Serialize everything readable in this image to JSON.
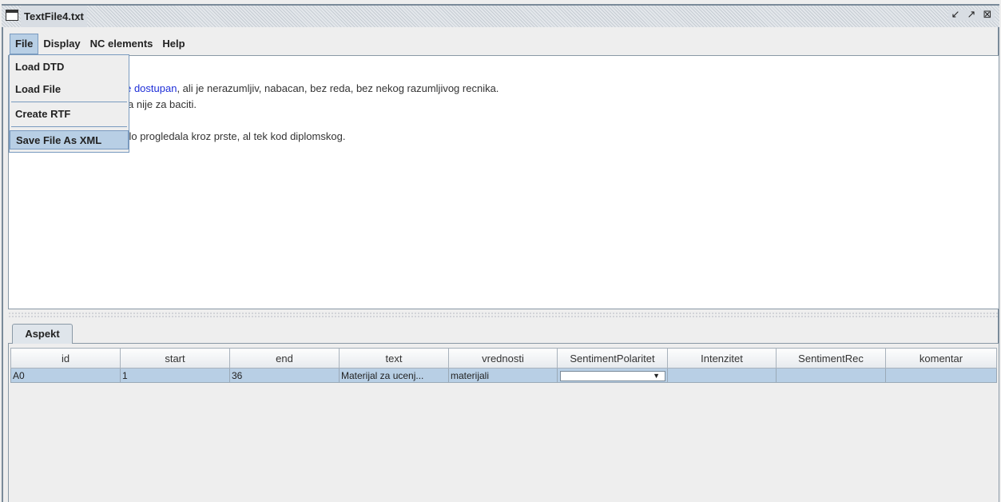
{
  "window": {
    "title": "TextFile4.txt"
  },
  "menubar": {
    "items": [
      "File",
      "Display",
      "NC elements",
      "Help"
    ]
  },
  "file_menu": {
    "items": [
      "Load DTD",
      "Load File",
      "Create RTF",
      "Save File As XML"
    ],
    "selected": "Save File As XML"
  },
  "editor": {
    "line1_highlight": "ste dostupan",
    "line1_rest": ", ali je nerazumljiv, nabacan, bez reda, bez nekog razumljivog recnika.",
    "line2": "nija nije za baciti.",
    "line3": "nalo progledala kroz prste, al tek kod diplomskog.",
    "highlight_color": "#1f2fd8"
  },
  "tab": {
    "label": "Aspekt"
  },
  "table": {
    "columns": [
      "id",
      "start",
      "end",
      "text",
      "vrednosti",
      "SentimentPolaritet",
      "Intenzitet",
      "SentimentRec",
      "komentar"
    ],
    "rows": [
      {
        "id": "A0",
        "start": "1",
        "end": "36",
        "text": "Materijal za ucenj...",
        "vrednosti": "materijali",
        "SentimentPolaritet": "",
        "Intenzitet": "",
        "SentimentRec": "",
        "komentar": ""
      }
    ]
  },
  "colors": {
    "selection": "#b8cfe5",
    "border": "#7a9bbf"
  }
}
